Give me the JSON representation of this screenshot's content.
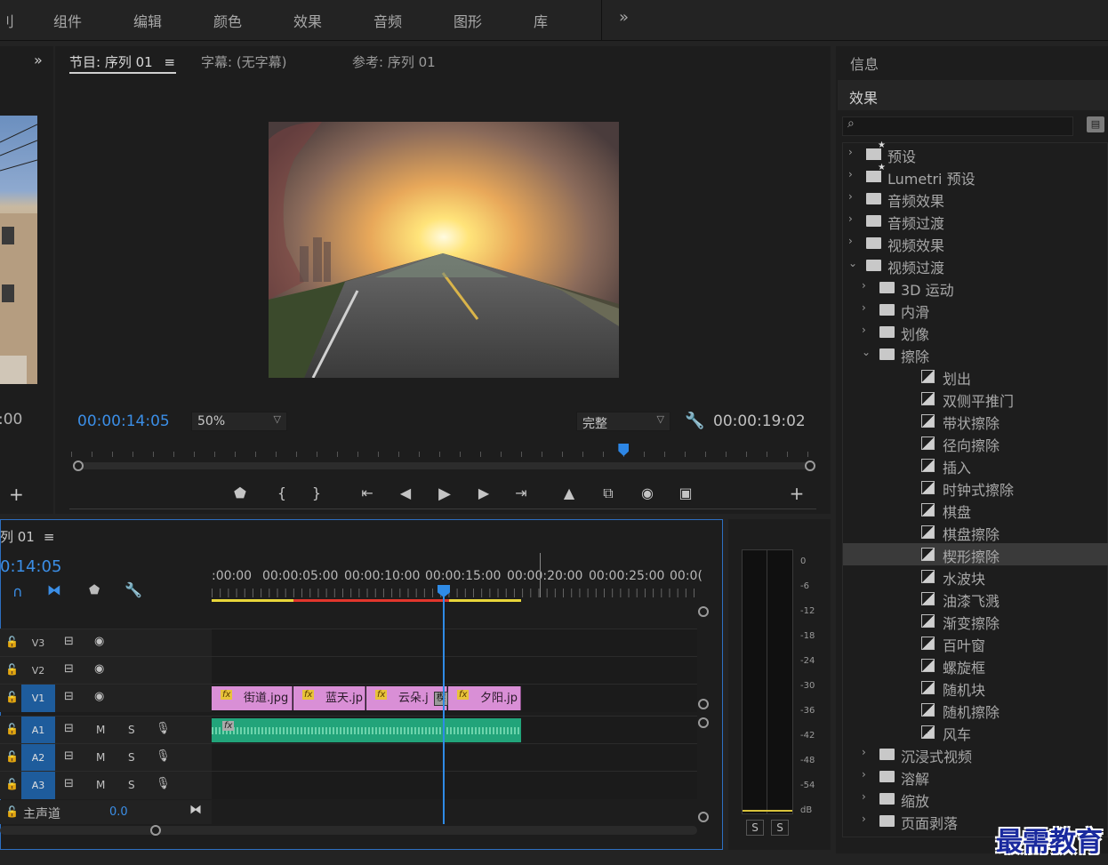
{
  "menu": {
    "items": [
      "组件",
      "编辑",
      "颜色",
      "效果",
      "音频",
      "图形",
      "库"
    ],
    "overflow": "»",
    "partial_left": "刂"
  },
  "source": {
    "timecode_partial": ":00",
    "expand": "»",
    "add": "+"
  },
  "program": {
    "tabs": {
      "program": "节目: 序列 01",
      "program_menu": "≡",
      "captions": "字幕: (无字幕)",
      "reference": "参考: 序列 01"
    },
    "timecode_current": "00:00:14:05",
    "zoom": "50%",
    "quality": "完整",
    "timecode_duration": "00:00:19:02",
    "playhead_fraction": 0.745,
    "controls": [
      "marker-icon",
      "mark-in-icon",
      "mark-out-icon",
      "go-to-in-icon",
      "step-back-icon",
      "play-icon",
      "step-forward-icon",
      "go-to-out-icon",
      "lift-icon",
      "extract-icon",
      "export-frame-icon",
      "compare-icon"
    ],
    "add": "+"
  },
  "effects": {
    "info_tab": "信息",
    "title": "效果",
    "search_placeholder": "",
    "tree": [
      {
        "label": "预设",
        "level": 0,
        "kind": "preset",
        "open": false
      },
      {
        "label": "Lumetri 预设",
        "level": 0,
        "kind": "preset",
        "open": false
      },
      {
        "label": "音频效果",
        "level": 0,
        "kind": "folder",
        "open": false
      },
      {
        "label": "音频过渡",
        "level": 0,
        "kind": "folder",
        "open": false
      },
      {
        "label": "视频效果",
        "level": 0,
        "kind": "folder",
        "open": false
      },
      {
        "label": "视频过渡",
        "level": 0,
        "kind": "folder",
        "open": true
      },
      {
        "label": "3D 运动",
        "level": 1,
        "kind": "folder",
        "open": false
      },
      {
        "label": "内滑",
        "level": 1,
        "kind": "folder",
        "open": false
      },
      {
        "label": "划像",
        "level": 1,
        "kind": "folder",
        "open": false
      },
      {
        "label": "擦除",
        "level": 1,
        "kind": "folder",
        "open": true
      },
      {
        "label": "划出",
        "level": 2,
        "kind": "fx"
      },
      {
        "label": "双侧平推门",
        "level": 2,
        "kind": "fx"
      },
      {
        "label": "带状擦除",
        "level": 2,
        "kind": "fx"
      },
      {
        "label": "径向擦除",
        "level": 2,
        "kind": "fx"
      },
      {
        "label": "插入",
        "level": 2,
        "kind": "fx"
      },
      {
        "label": "时钟式擦除",
        "level": 2,
        "kind": "fx"
      },
      {
        "label": "棋盘",
        "level": 2,
        "kind": "fx"
      },
      {
        "label": "棋盘擦除",
        "level": 2,
        "kind": "fx"
      },
      {
        "label": "楔形擦除",
        "level": 2,
        "kind": "fx",
        "selected": true
      },
      {
        "label": "水波块",
        "level": 2,
        "kind": "fx"
      },
      {
        "label": "油漆飞溅",
        "level": 2,
        "kind": "fx"
      },
      {
        "label": "渐变擦除",
        "level": 2,
        "kind": "fx"
      },
      {
        "label": "百叶窗",
        "level": 2,
        "kind": "fx"
      },
      {
        "label": "螺旋框",
        "level": 2,
        "kind": "fx"
      },
      {
        "label": "随机块",
        "level": 2,
        "kind": "fx"
      },
      {
        "label": "随机擦除",
        "level": 2,
        "kind": "fx"
      },
      {
        "label": "风车",
        "level": 2,
        "kind": "fx"
      },
      {
        "label": "沉浸式视频",
        "level": 1,
        "kind": "folder",
        "open": false
      },
      {
        "label": "溶解",
        "level": 1,
        "kind": "folder",
        "open": false
      },
      {
        "label": "缩放",
        "level": 1,
        "kind": "folder",
        "open": false
      },
      {
        "label": "页面剥落",
        "level": 1,
        "kind": "folder",
        "open": false
      }
    ]
  },
  "timeline": {
    "name_partial": "列 01",
    "menu": "≡",
    "timecode_partial": "0:14:05",
    "ruler": [
      ":00:00",
      "00:00:05:00",
      "00:00:10:00",
      "00:00:15:00",
      "00:00:20:00",
      "00:00:25:00",
      "00:0("
    ],
    "tracks": [
      {
        "name": "V3",
        "type": "video",
        "active": false
      },
      {
        "name": "V2",
        "type": "video",
        "active": false
      },
      {
        "name": "V1",
        "type": "video",
        "active": true
      },
      {
        "name": "A1",
        "type": "audio",
        "active": true
      },
      {
        "name": "A2",
        "type": "audio",
        "active": true
      },
      {
        "name": "A3",
        "type": "audio",
        "active": true
      }
    ],
    "clips": [
      {
        "label": "街道.jpg",
        "fx": "fx"
      },
      {
        "label": "蓝天.jp",
        "fx": "fx"
      },
      {
        "label": "云朵.j",
        "fx": "fx"
      },
      {
        "label": "夕阳.jp",
        "fx": "fx"
      }
    ],
    "transition_label": "楔",
    "audio_fx": "fx",
    "master": {
      "label": "主声道",
      "value": "0.0"
    },
    "mute_label": "M",
    "solo_label": "S"
  },
  "meter": {
    "scale": [
      "0",
      "-6",
      "-12",
      "-18",
      "-24",
      "-30",
      "-36",
      "-42",
      "-48",
      "-54",
      "dB"
    ],
    "solo_left": "S",
    "solo_right": "S"
  },
  "watermark": "最需教育",
  "colors": {
    "accent_blue": "#2f8be6",
    "clip_pink": "#d98fd6",
    "audio_green": "#22a47a",
    "workarea_yellow": "#e8d63a",
    "workarea_red": "#e2362c"
  }
}
